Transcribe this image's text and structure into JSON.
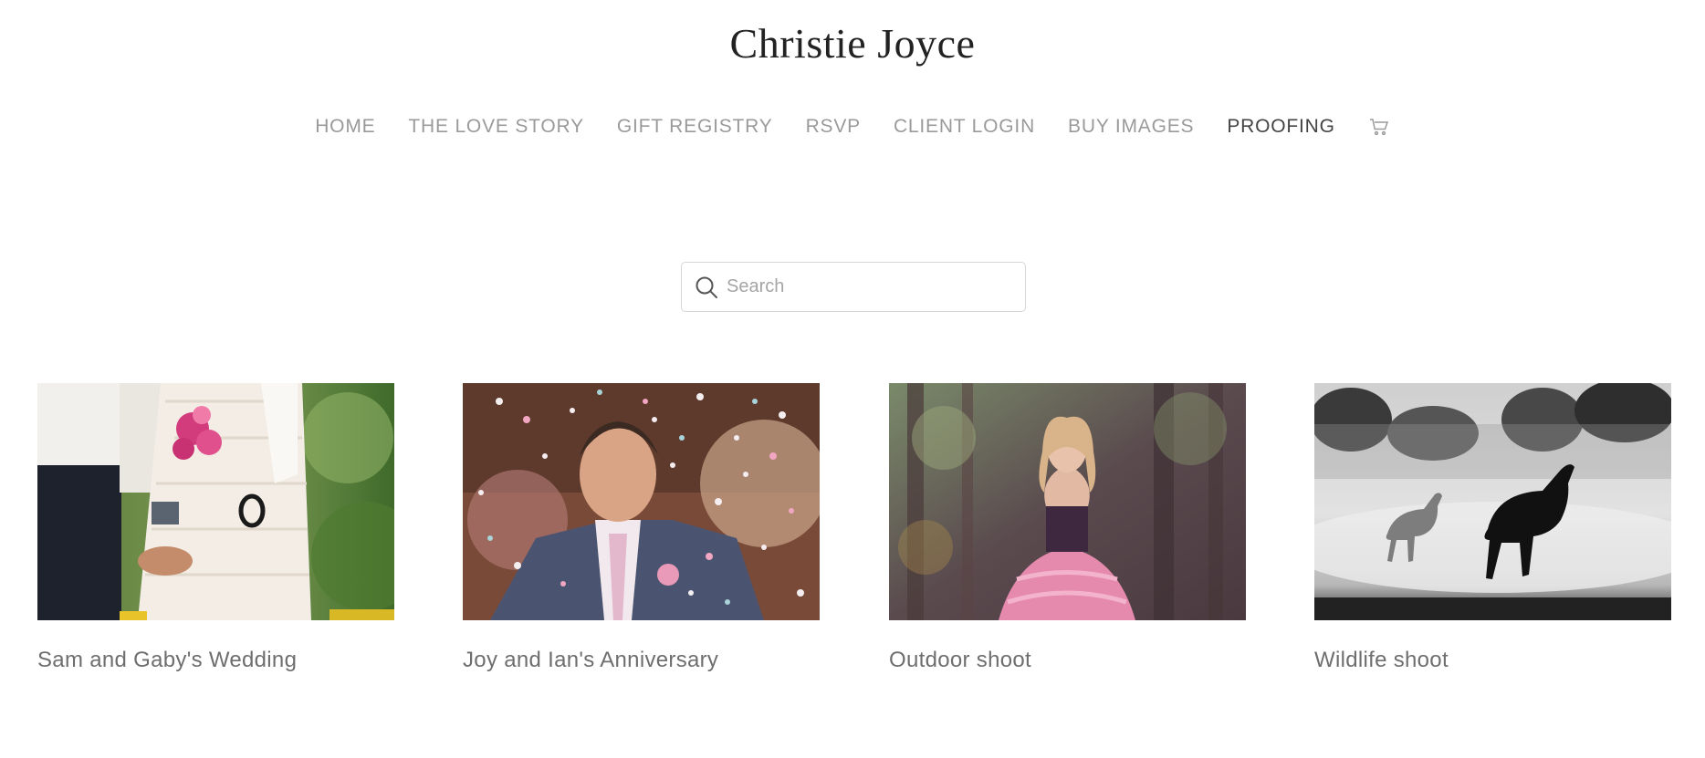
{
  "site": {
    "title": "Christie Joyce"
  },
  "nav": {
    "items": [
      {
        "label": "HOME",
        "active": false
      },
      {
        "label": "THE LOVE STORY",
        "active": false
      },
      {
        "label": "GIFT REGISTRY",
        "active": false
      },
      {
        "label": "RSVP",
        "active": false
      },
      {
        "label": "CLIENT LOGIN",
        "active": false
      },
      {
        "label": "BUY IMAGES",
        "active": false
      },
      {
        "label": "PROOFING",
        "active": true
      }
    ],
    "cart_icon": "cart-icon"
  },
  "search": {
    "placeholder": "Search",
    "value": "",
    "icon": "search-icon"
  },
  "gallery": {
    "items": [
      {
        "label": "Sam and Gaby's Wedding",
        "image": "wedding-couple-holding-hands-photo"
      },
      {
        "label": "Joy and Ian's Anniversary",
        "image": "groom-confetti-photo"
      },
      {
        "label": "Outdoor shoot",
        "image": "woman-pink-dress-forest-photo"
      },
      {
        "label": "Wildlife shoot",
        "image": "horses-running-mist-bw-photo"
      }
    ]
  },
  "colors": {
    "nav_text": "#9a9a9a",
    "nav_active": "#444444",
    "label_text": "#6e6e6e",
    "title_text": "#222222",
    "border": "#d6d6d6"
  }
}
